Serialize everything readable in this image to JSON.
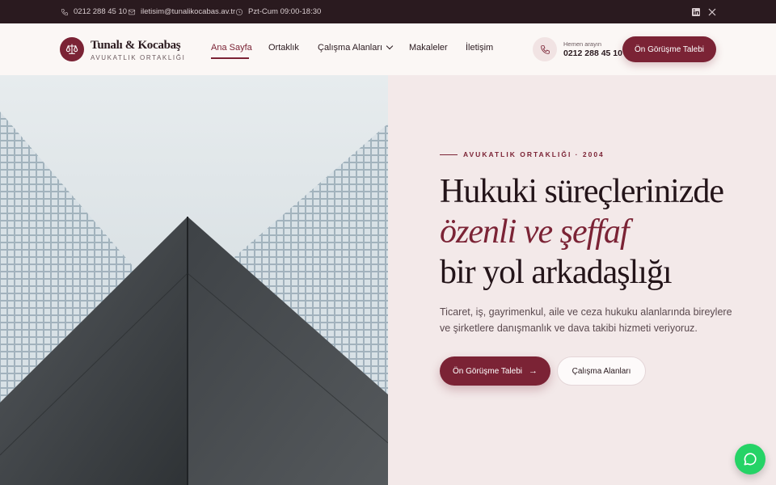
{
  "topbar": {
    "phone": "0212 288 45 10",
    "email": "iletisim@tunalikocabas.av.tr",
    "hours": "Pzt-Cum 09:00-18:30",
    "social": [
      "linkedin-icon",
      "x-icon"
    ]
  },
  "brand": {
    "name": "Tunalı & Kocabaş",
    "tagline": "AVUKATLIK ORTAKLIĞI",
    "icon": "scales-icon",
    "color": "#7b2335"
  },
  "nav": {
    "items": [
      {
        "label": "Ana Sayfa",
        "active": true
      },
      {
        "label": "Ortaklık"
      },
      {
        "label": "Çalışma Alanları",
        "dropdown": true
      },
      {
        "label": "Makaleler"
      },
      {
        "label": "İletişim"
      }
    ]
  },
  "contact": {
    "label": "Hemen arayın",
    "number": "0212 288 45 10"
  },
  "header_cta": "Ön Görüşme Talebi",
  "hero": {
    "eyebrow": "AVUKATLIK ORTAKLIĞI · 2004",
    "title_line1": "Hukuki süreçlerinizde",
    "title_line2": "özenli ve şeffaf",
    "title_line3": "bir yol arkadaşlığı",
    "lead": "Ticaret, iş, gayrimenkul, aile ve ceza hukuku alanlarında bireylere ve şirketlere danışmanlık ve dava takibi hizmeti veriyoruz.",
    "primary_cta": "Ön Görüşme Talebi",
    "secondary_cta": "Çalışma Alanları"
  },
  "colors": {
    "accent": "#7b2335",
    "topbar": "#2a1a1f",
    "hero_bg": "#f3e9e9",
    "whatsapp": "#25d366"
  }
}
